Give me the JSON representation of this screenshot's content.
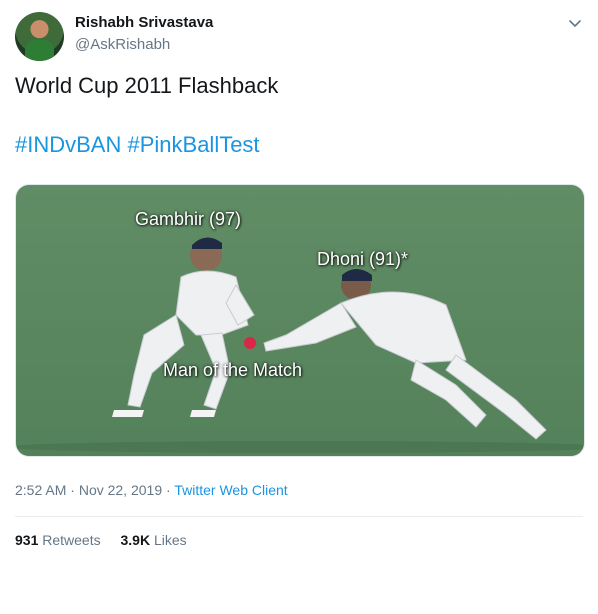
{
  "author": {
    "name": "Rishabh Srivastava",
    "handle": "@AskRishabh"
  },
  "tweet": {
    "text": "World Cup 2011 Flashback",
    "hashtags": [
      "#INDvBAN",
      "#PinkBallTest"
    ]
  },
  "media": {
    "labels": {
      "gambhir": "Gambhir (97)",
      "dhoni": "Dhoni (91)*",
      "motm": "Man of the Match"
    }
  },
  "meta": {
    "time": "2:52 AM",
    "separator1": " · ",
    "date": "Nov 22, 2019",
    "separator2": " · ",
    "client": "Twitter Web Client"
  },
  "stats": {
    "retweets_count": "931",
    "retweets_label": "Retweets",
    "likes_count": "3.9K",
    "likes_label": "Likes"
  },
  "colors": {
    "link": "#1b95e0",
    "secondary_text": "#657786",
    "primary_text": "#14171a"
  },
  "icons": {
    "menu": "chevron-down-icon"
  }
}
